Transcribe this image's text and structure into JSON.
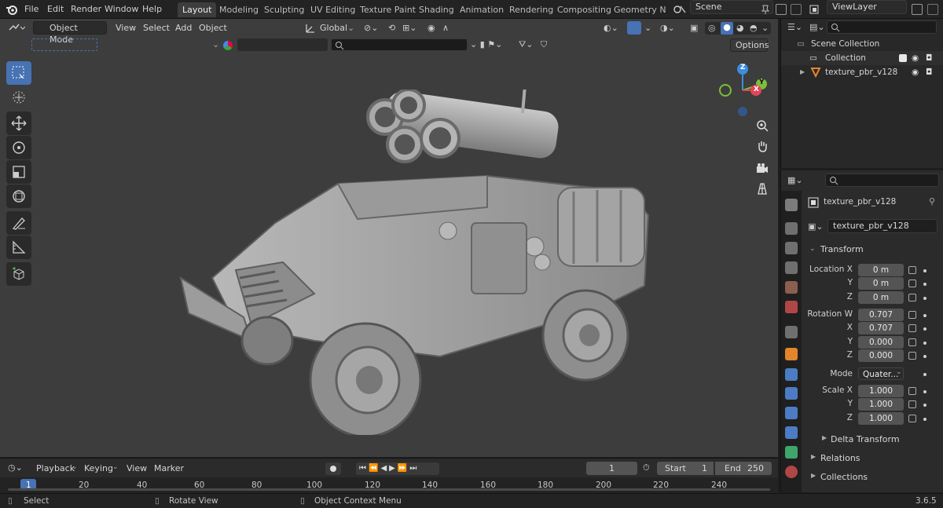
{
  "menu": {
    "file": "File",
    "edit": "Edit",
    "render": "Render",
    "window": "Window",
    "help": "Help"
  },
  "workspaces": [
    "Layout",
    "Modeling",
    "Sculpting",
    "UV Editing",
    "Texture Paint",
    "Shading",
    "Animation",
    "Rendering",
    "Compositing",
    "Geometry Noc"
  ],
  "scene": "Scene",
  "view_layer": "ViewLayer",
  "viewport": {
    "mode": "Object Mode",
    "menus": {
      "view": "View",
      "select": "Select",
      "add": "Add",
      "object": "Object"
    },
    "orientation": "Global",
    "options": "Options",
    "gizmo": {
      "x": "X",
      "y": "Y",
      "z": "Z"
    }
  },
  "outliner": {
    "scene_collection": "Scene Collection",
    "collection": "Collection",
    "object": "texture_pbr_v128"
  },
  "properties": {
    "object_name": "texture_pbr_v128",
    "object_field": "texture_pbr_v128",
    "transform_title": "Transform",
    "location_label": "Location X",
    "location": [
      "0 m",
      "0 m",
      "0 m"
    ],
    "rotation_label": "Rotation W",
    "rotation": [
      "0.707",
      "0.707",
      "0.000",
      "0.000"
    ],
    "mode_label": "Mode",
    "mode_value": "Quater...",
    "scale_label": "Scale X",
    "scale": [
      "1.000",
      "1.000",
      "1.000"
    ],
    "axis_y": "Y",
    "axis_z": "Z",
    "axis_x": "X",
    "delta_transform": "Delta Transform",
    "relations": "Relations",
    "collections": "Collections"
  },
  "timeline": {
    "playback": "Playback",
    "keying": "Keying",
    "view": "View",
    "marker": "Marker",
    "current_frame": "1",
    "start_label": "Start",
    "start": "1",
    "end_label": "End",
    "end": "250",
    "ticks": [
      "1",
      "20",
      "40",
      "60",
      "80",
      "100",
      "120",
      "140",
      "160",
      "180",
      "200",
      "220",
      "240"
    ]
  },
  "status": {
    "select": "Select",
    "rotate": "Rotate View",
    "context": "Object Context Menu",
    "version": "3.6.5"
  },
  "colors": {
    "accent": "#4772b3",
    "axis_x": "#e0455a",
    "axis_y": "#7bbf3a",
    "axis_z": "#3d8ce0",
    "object_orange": "#e3852b"
  }
}
